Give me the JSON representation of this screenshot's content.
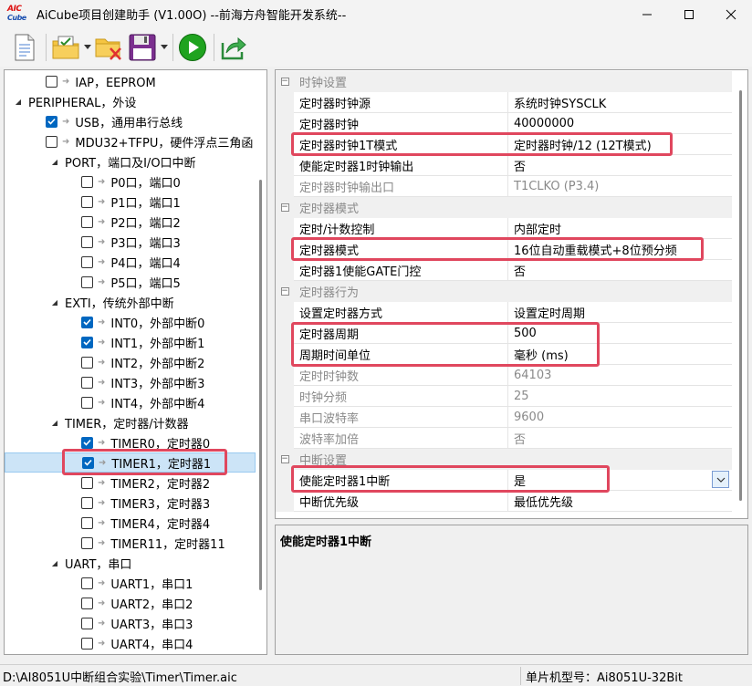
{
  "window": {
    "title": "AiCube项目创建助手 (V1.00O) --前海方舟智能开发系统--",
    "logo_text_top": "AIC",
    "logo_text_bottom": "Cube"
  },
  "toolbar": {
    "buttons": [
      {
        "name": "new-document",
        "icon": "document-icon"
      },
      {
        "name": "open-folder",
        "icon": "folder-check-icon"
      },
      {
        "name": "delete-folder",
        "icon": "folder-delete-icon"
      },
      {
        "name": "save",
        "icon": "floppy-disk-icon"
      },
      {
        "name": "run",
        "icon": "play-icon"
      },
      {
        "name": "export",
        "icon": "export-arrow-icon"
      }
    ]
  },
  "tree": {
    "items": [
      {
        "level": 2,
        "expander": "",
        "checkbox": true,
        "checked": false,
        "arrow": true,
        "label": "IAP，EEPROM"
      },
      {
        "level": 0,
        "expander": "◢",
        "checkbox": false,
        "checked": false,
        "arrow": false,
        "label": "PERIPHERAL，外设"
      },
      {
        "level": 2,
        "expander": "",
        "checkbox": true,
        "checked": true,
        "arrow": true,
        "label": "USB，通用串行总线"
      },
      {
        "level": 2,
        "expander": "",
        "checkbox": true,
        "checked": false,
        "arrow": true,
        "label": "MDU32+TFPU，硬件浮点三角函"
      },
      {
        "level": 1,
        "expander": "◢",
        "checkbox": false,
        "checked": false,
        "arrow": false,
        "label": "PORT，端口及I/O口中断"
      },
      {
        "level": 3,
        "expander": "",
        "checkbox": true,
        "checked": false,
        "arrow": true,
        "label": "P0口，端口0"
      },
      {
        "level": 3,
        "expander": "",
        "checkbox": true,
        "checked": false,
        "arrow": true,
        "label": "P1口，端口1"
      },
      {
        "level": 3,
        "expander": "",
        "checkbox": true,
        "checked": false,
        "arrow": true,
        "label": "P2口，端口2"
      },
      {
        "level": 3,
        "expander": "",
        "checkbox": true,
        "checked": false,
        "arrow": true,
        "label": "P3口，端口3"
      },
      {
        "level": 3,
        "expander": "",
        "checkbox": true,
        "checked": false,
        "arrow": true,
        "label": "P4口，端口4"
      },
      {
        "level": 3,
        "expander": "",
        "checkbox": true,
        "checked": false,
        "arrow": true,
        "label": "P5口，端口5"
      },
      {
        "level": 1,
        "expander": "◢",
        "checkbox": false,
        "checked": false,
        "arrow": false,
        "label": "EXTI，传统外部中断"
      },
      {
        "level": 3,
        "expander": "",
        "checkbox": true,
        "checked": true,
        "arrow": true,
        "label": "INT0，外部中断0"
      },
      {
        "level": 3,
        "expander": "",
        "checkbox": true,
        "checked": true,
        "arrow": true,
        "label": "INT1，外部中断1"
      },
      {
        "level": 3,
        "expander": "",
        "checkbox": true,
        "checked": false,
        "arrow": true,
        "label": "INT2，外部中断2"
      },
      {
        "level": 3,
        "expander": "",
        "checkbox": true,
        "checked": false,
        "arrow": true,
        "label": "INT3，外部中断3"
      },
      {
        "level": 3,
        "expander": "",
        "checkbox": true,
        "checked": false,
        "arrow": true,
        "label": "INT4，外部中断4"
      },
      {
        "level": 1,
        "expander": "◢",
        "checkbox": false,
        "checked": false,
        "arrow": false,
        "label": "TIMER，定时器/计数器"
      },
      {
        "level": 3,
        "expander": "",
        "checkbox": true,
        "checked": true,
        "arrow": true,
        "label": "TIMER0，定时器0"
      },
      {
        "level": 3,
        "expander": "",
        "checkbox": true,
        "checked": true,
        "arrow": true,
        "label": "TIMER1，定时器1",
        "selected": true
      },
      {
        "level": 3,
        "expander": "",
        "checkbox": true,
        "checked": false,
        "arrow": true,
        "label": "TIMER2，定时器2"
      },
      {
        "level": 3,
        "expander": "",
        "checkbox": true,
        "checked": false,
        "arrow": true,
        "label": "TIMER3，定时器3"
      },
      {
        "level": 3,
        "expander": "",
        "checkbox": true,
        "checked": false,
        "arrow": true,
        "label": "TIMER4，定时器4"
      },
      {
        "level": 3,
        "expander": "",
        "checkbox": true,
        "checked": false,
        "arrow": true,
        "label": "TIMER11，定时器11"
      },
      {
        "level": 1,
        "expander": "◢",
        "checkbox": false,
        "checked": false,
        "arrow": false,
        "label": "UART，串口"
      },
      {
        "level": 3,
        "expander": "",
        "checkbox": true,
        "checked": false,
        "arrow": true,
        "label": "UART1，串口1"
      },
      {
        "level": 3,
        "expander": "",
        "checkbox": true,
        "checked": false,
        "arrow": true,
        "label": "UART2，串口2"
      },
      {
        "level": 3,
        "expander": "",
        "checkbox": true,
        "checked": false,
        "arrow": true,
        "label": "UART3，串口3"
      },
      {
        "level": 3,
        "expander": "",
        "checkbox": true,
        "checked": false,
        "arrow": true,
        "label": "UART4，串口4"
      }
    ]
  },
  "properties": {
    "rows": [
      {
        "type": "category",
        "name": "时钟设置"
      },
      {
        "type": "prop",
        "name": "定时器时钟源",
        "value": "系统时钟SYSCLK",
        "disabled": false
      },
      {
        "type": "prop",
        "name": "定时器时钟",
        "value": "40000000",
        "disabled": false
      },
      {
        "type": "prop",
        "name": "定时器时钟1T模式",
        "value": "定时器时钟/12 (12T模式)",
        "disabled": false
      },
      {
        "type": "prop",
        "name": "使能定时器1时钟输出",
        "value": "否",
        "disabled": false
      },
      {
        "type": "prop",
        "name": "定时器时钟输出口",
        "value": "T1CLKO (P3.4)",
        "disabled": true
      },
      {
        "type": "category",
        "name": "定时器模式"
      },
      {
        "type": "prop",
        "name": "定时/计数控制",
        "value": "内部定时",
        "disabled": false
      },
      {
        "type": "prop",
        "name": "定时器模式",
        "value": "16位自动重载模式+8位预分频",
        "disabled": false
      },
      {
        "type": "prop",
        "name": "定时器1使能GATE门控",
        "value": "否",
        "disabled": false
      },
      {
        "type": "category",
        "name": "定时器行为"
      },
      {
        "type": "prop",
        "name": "设置定时器方式",
        "value": "设置定时周期",
        "disabled": false
      },
      {
        "type": "prop",
        "name": "定时器周期",
        "value": "500",
        "disabled": false
      },
      {
        "type": "prop",
        "name": "周期时间单位",
        "value": "毫秒 (ms)",
        "disabled": false
      },
      {
        "type": "prop",
        "name": "定时时钟数",
        "value": "64103",
        "disabled": true
      },
      {
        "type": "prop",
        "name": "时钟分频",
        "value": "25",
        "disabled": true
      },
      {
        "type": "prop",
        "name": "串口波特率",
        "value": "9600",
        "disabled": true
      },
      {
        "type": "prop",
        "name": "波特率加倍",
        "value": "否",
        "disabled": true
      },
      {
        "type": "category",
        "name": "中断设置"
      },
      {
        "type": "prop",
        "name": "使能定时器1中断",
        "value": "是",
        "disabled": false,
        "has_dropdown": true
      },
      {
        "type": "prop",
        "name": "中断优先级",
        "value": "最低优先级",
        "disabled": false
      }
    ]
  },
  "description": {
    "title": "使能定时器1中断"
  },
  "statusbar": {
    "path": "D:\\AI8051U中断组合实验\\Timer\\Timer.aic",
    "mcu": "单片机型号：Ai8051U-32Bit"
  },
  "colors": {
    "highlight": "#e0475e",
    "checkbox_checked": "#0067c0",
    "selected_row": "#cce4f7",
    "play_green": "#1fa31f"
  }
}
